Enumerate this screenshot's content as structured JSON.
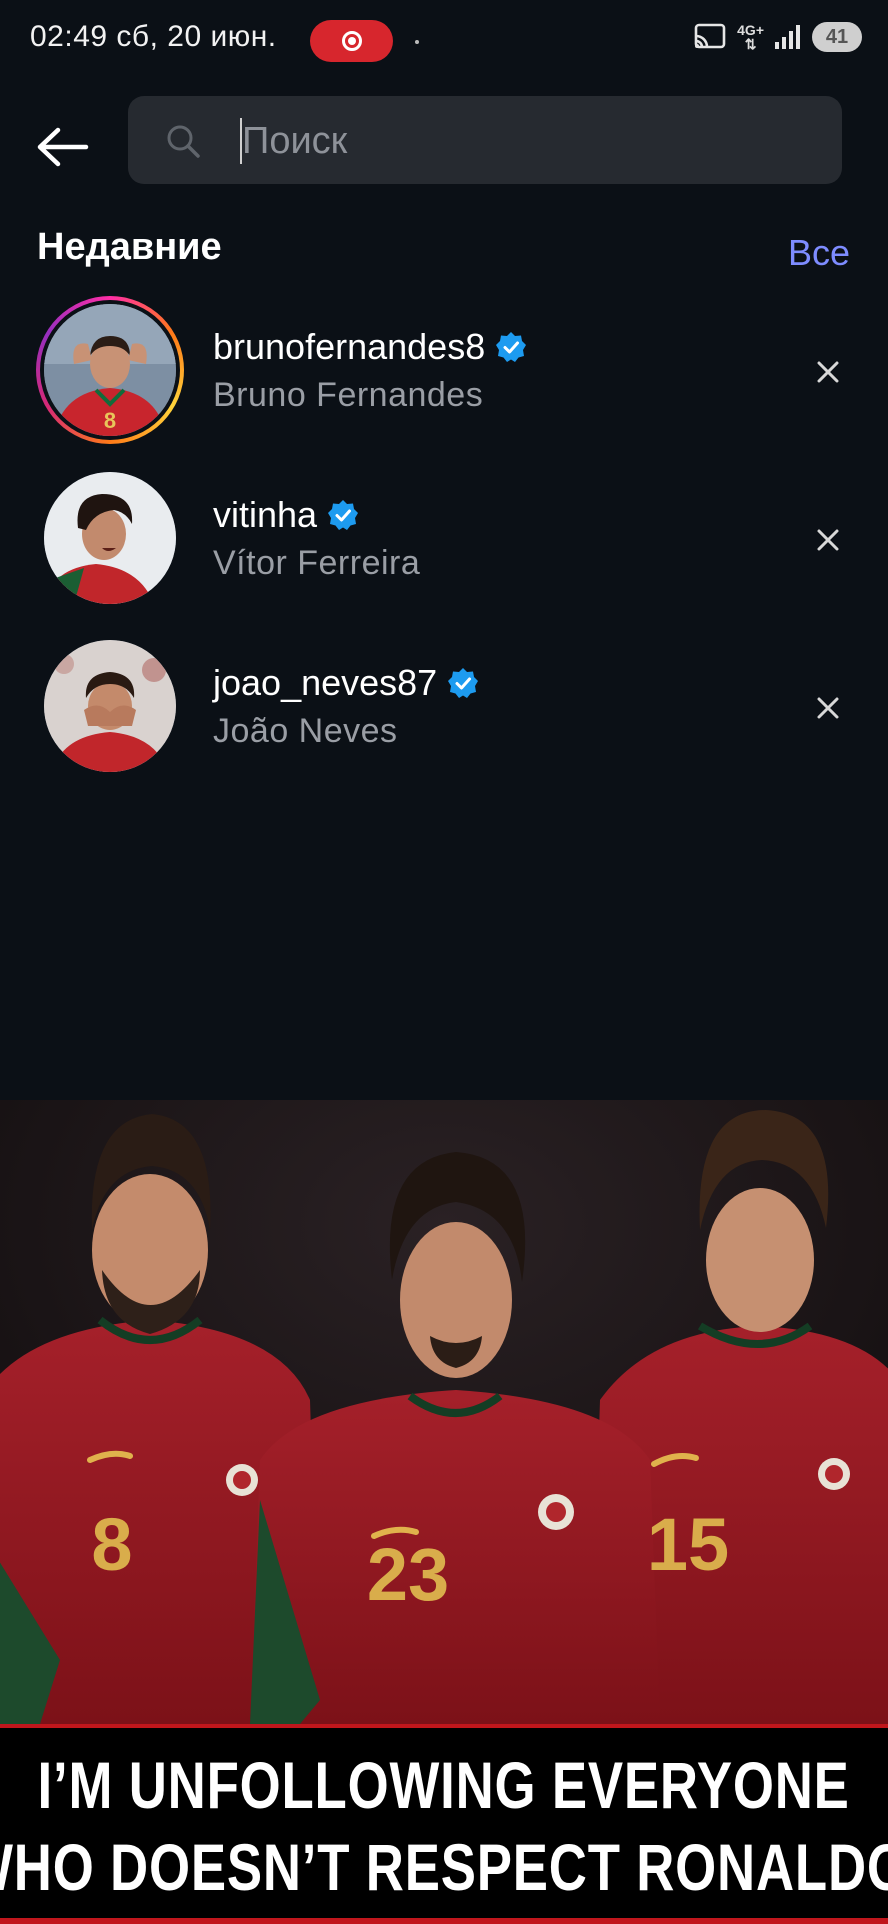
{
  "status_bar": {
    "time_date": "02:49  сб, 20 июн.",
    "network": "4G+",
    "battery": "41"
  },
  "search": {
    "placeholder": "Поиск",
    "value": ""
  },
  "recent": {
    "title": "Недавние",
    "see_all": "Все",
    "items": [
      {
        "username": "brunofernandes8",
        "full_name": "Bruno Fernandes",
        "verified": true,
        "has_story": true
      },
      {
        "username": "vitinha",
        "full_name": "Vítor Ferreira",
        "verified": true,
        "has_story": false
      },
      {
        "username": "joao_neves87",
        "full_name": "João Neves",
        "verified": true,
        "has_story": false
      }
    ]
  },
  "post": {
    "jersey_numbers": [
      "8",
      "23",
      "15"
    ],
    "caption_lines": [
      "I’M UNFOLLOWING EVERYONE",
      "WHO DOESN’T RESPECT RONALDO."
    ]
  },
  "icons": {
    "back": "arrow-left-icon",
    "search": "search-icon",
    "remove": "close-icon",
    "verified": "verified-badge-icon",
    "cast": "cast-icon",
    "signal": "signal-icon"
  },
  "colors": {
    "background": "#0b1016",
    "accent_link": "#7e8cff",
    "verified": "#1da1f2",
    "record": "#d7262d",
    "jersey": "#9e1b22"
  }
}
